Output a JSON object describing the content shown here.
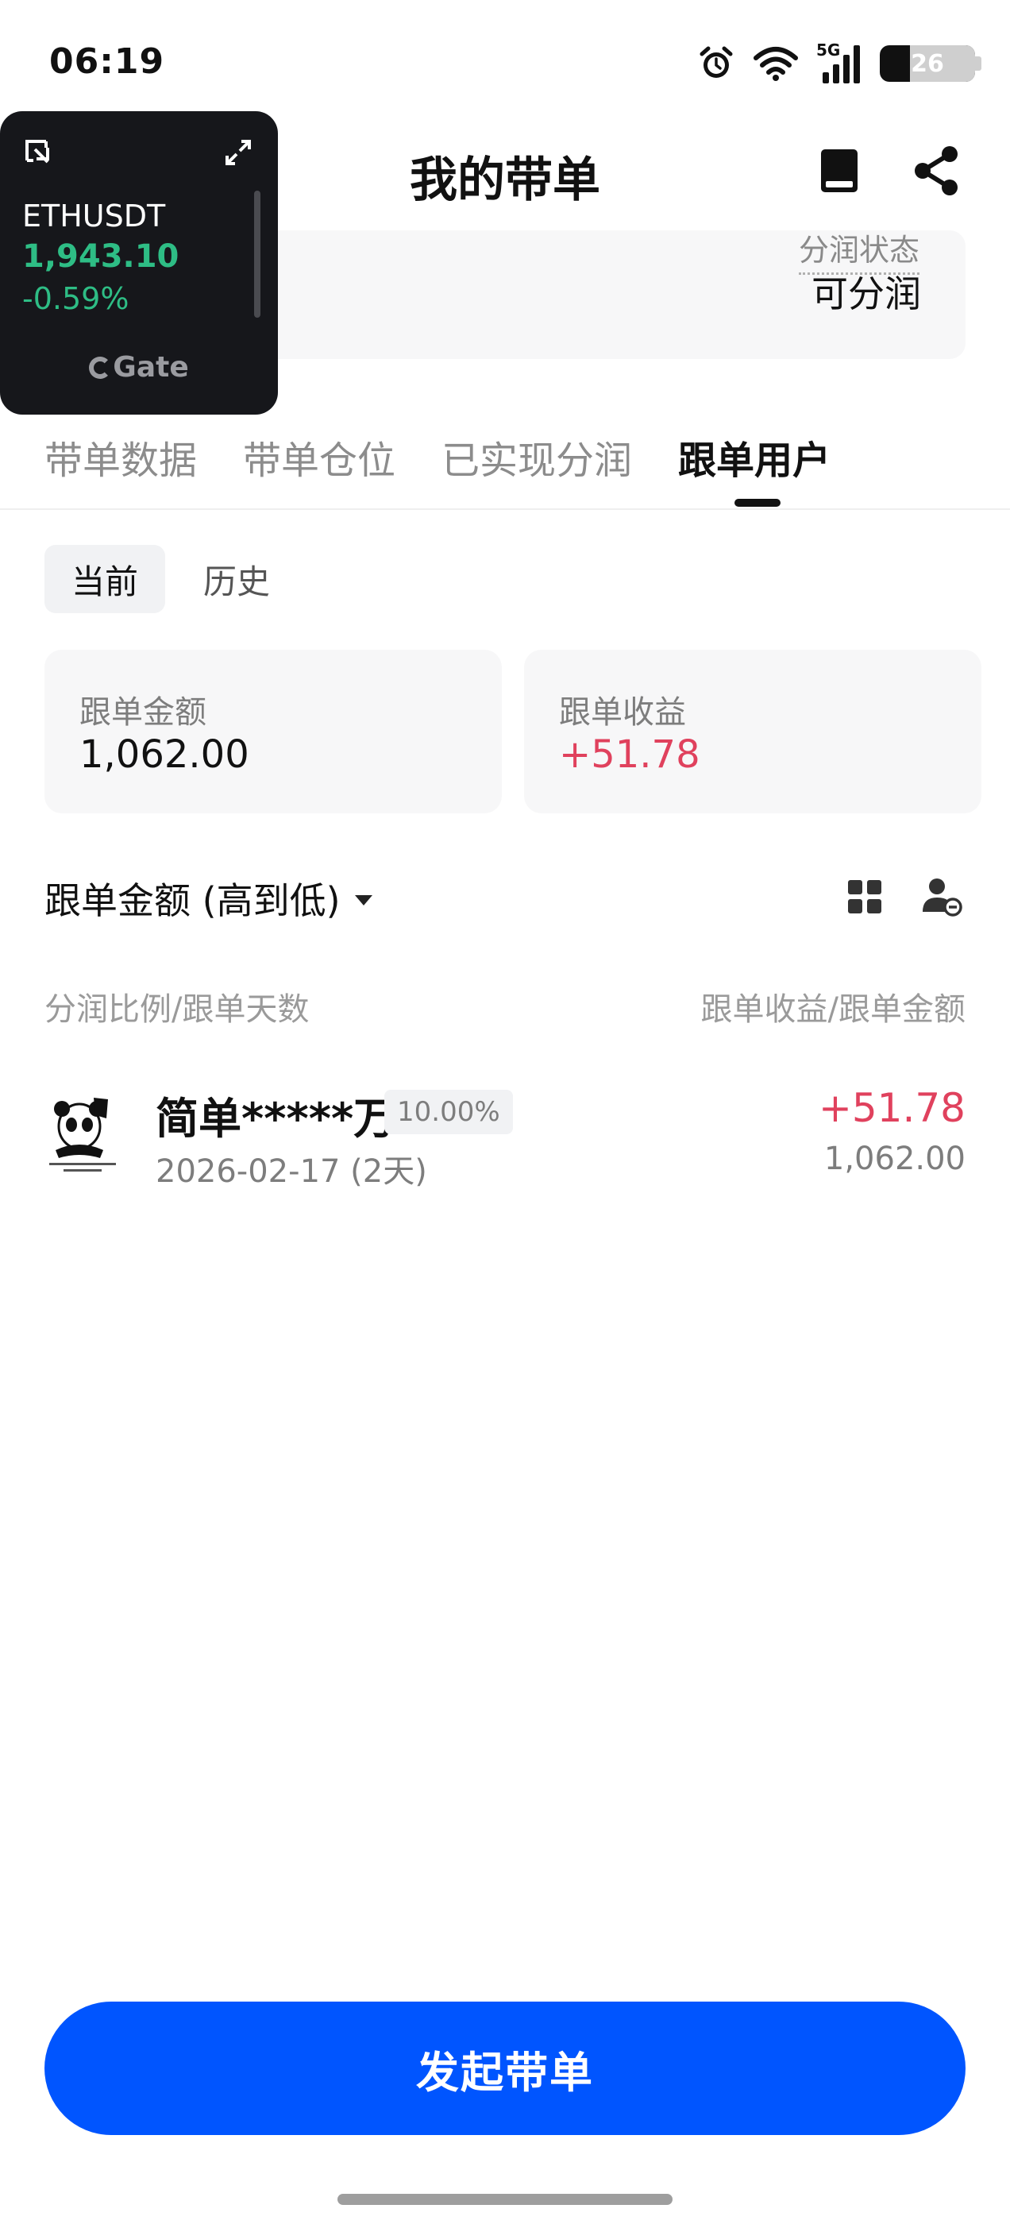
{
  "status_bar": {
    "time": "06:19",
    "network": "5G",
    "battery": "26"
  },
  "header": {
    "title": "我的带单"
  },
  "info_card": {
    "profit_status_label": "分润状态",
    "profit_status_value": "可分润"
  },
  "widget": {
    "symbol": "ETHUSDT",
    "price": "1,943.10",
    "change": "-0.59%",
    "logo_text": "Gate",
    "price_color": "#2ebd85"
  },
  "tabs": [
    {
      "label": "带单数据"
    },
    {
      "label": "带单仓位"
    },
    {
      "label": "已实现分润"
    },
    {
      "label": "跟单用户"
    }
  ],
  "sub_tabs": {
    "current": "当前",
    "history": "历史"
  },
  "summary": {
    "amount_label": "跟单金额",
    "amount_value": "1,062.00",
    "pnl_label": "跟单收益",
    "pnl_value": "+51.78"
  },
  "sort": {
    "label": "跟单金额 (高到低)"
  },
  "columns": {
    "left": "分润比例/跟单天数",
    "right": "跟单收益/跟单金额"
  },
  "followers": [
    {
      "name": "简单*****万",
      "ratio": "10.00%",
      "date": "2026-02-17 (2天)",
      "profit": "+51.78",
      "amount": "1,062.00"
    }
  ],
  "cta": {
    "label": "发起带单"
  },
  "colors": {
    "accent": "#0055ff",
    "positive": "#e0415d",
    "widget_positive": "#2ebd85"
  }
}
